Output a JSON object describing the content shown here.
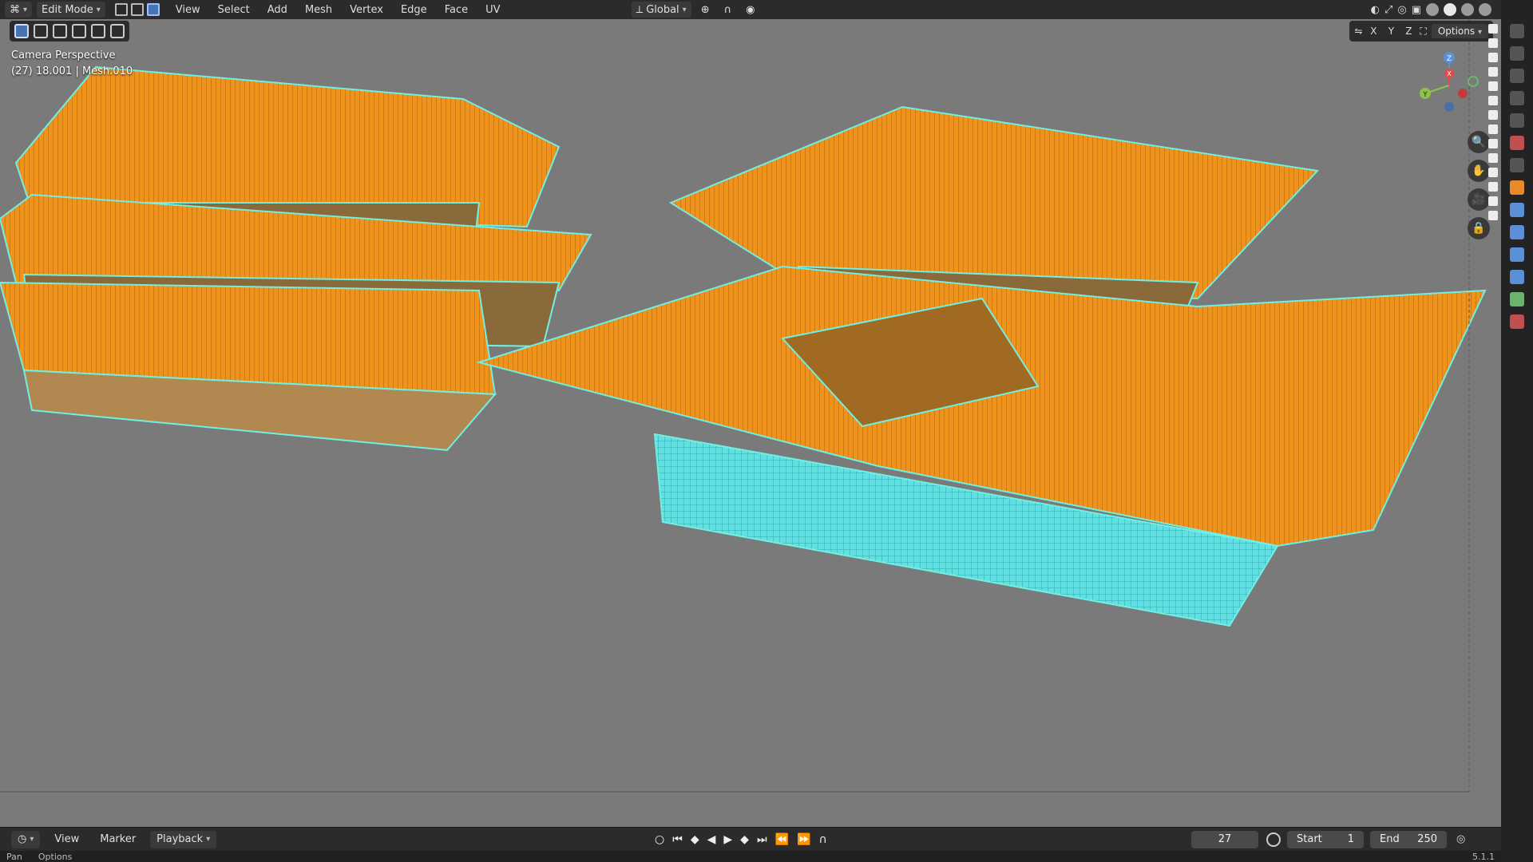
{
  "header": {
    "mode": "Edit Mode",
    "menus": [
      "View",
      "Select",
      "Add",
      "Mesh",
      "Vertex",
      "Edge",
      "Face",
      "UV"
    ],
    "transform_orientation": "Global"
  },
  "viewport": {
    "view_name": "Camera Perspective",
    "object_info": "(27) 18.001 | Mesh.010",
    "axis_x": "X",
    "axis_y": "Y",
    "axis_z": "Z",
    "options_label": "Options",
    "gizmo": {
      "x": "X",
      "y": "Y",
      "z": "Z"
    }
  },
  "timeline": {
    "menus": [
      "View",
      "Marker"
    ],
    "playback_label": "Playback",
    "current_frame": "27",
    "start_label": "Start",
    "start_value": "1",
    "end_label": "End",
    "end_value": "250"
  },
  "status": {
    "left": "Pan",
    "options": "Options",
    "version": "5.1.1"
  },
  "colors": {
    "roof": "#f29319",
    "wire": "#6ef0e3",
    "background": "#7a7a7a",
    "accent": "#4772b3"
  }
}
